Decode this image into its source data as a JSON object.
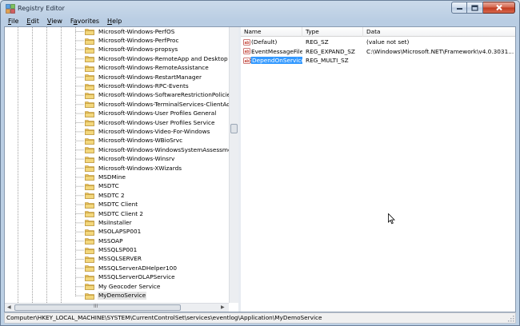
{
  "window": {
    "title": "Registry Editor"
  },
  "menu": [
    "File",
    "Edit",
    "View",
    "Favorites",
    "Help"
  ],
  "tree": {
    "items": [
      "Microsoft-Windows-PerfOS",
      "Microsoft-Windows-PerfProc",
      "Microsoft-Windows-propsys",
      "Microsoft-Windows-RemoteApp and Desktop Co",
      "Microsoft-Windows-RemoteAssistance",
      "Microsoft-Windows-RestartManager",
      "Microsoft-Windows-RPC-Events",
      "Microsoft-Windows-SoftwareRestrictionPolicies",
      "Microsoft-Windows-TerminalServices-ClientActi",
      "Microsoft-Windows-User Profiles General",
      "Microsoft-Windows-User Profiles Service",
      "Microsoft-Windows-Video-For-Windows",
      "Microsoft-Windows-WBioSrvc",
      "Microsoft-Windows-WindowsSystemAssessment",
      "Microsoft-Windows-Winsrv",
      "Microsoft-Windows-XWizards",
      "MSDMine",
      "MSDTC",
      "MSDTC 2",
      "MSDTC Client",
      "MSDTC Client 2",
      "MsiInstaller",
      "MSOLAPSP001",
      "MSSOAP",
      "MSSQLSP001",
      "MSSQLSERVER",
      "MSSQLServerADHelper100",
      "MSSQLServerOLAPService",
      "My Geocoder Service",
      "MyDemoService"
    ],
    "selected_index": 29
  },
  "list": {
    "headers": {
      "name": "Name",
      "type": "Type",
      "data": "Data"
    },
    "rows": [
      {
        "name": "(Default)",
        "type": "REG_SZ",
        "data": "(value not set)"
      },
      {
        "name": "EventMessageFile",
        "type": "REG_EXPAND_SZ",
        "data": "C:\\Windows\\Microsoft.NET\\Framework\\v4.0.3031..."
      },
      {
        "name": "DependOnService",
        "type": "REG_MULTI_SZ",
        "data": ""
      }
    ],
    "selected_index": 2
  },
  "hscroll_label": "III",
  "status": {
    "path": "Computer\\HKEY_LOCAL_MACHINE\\SYSTEM\\CurrentControlSet\\services\\eventlog\\Application\\MyDemoService"
  },
  "colors": {
    "selection": "#3399ff",
    "folder": "#e9c25b",
    "close": "#c0391e"
  }
}
